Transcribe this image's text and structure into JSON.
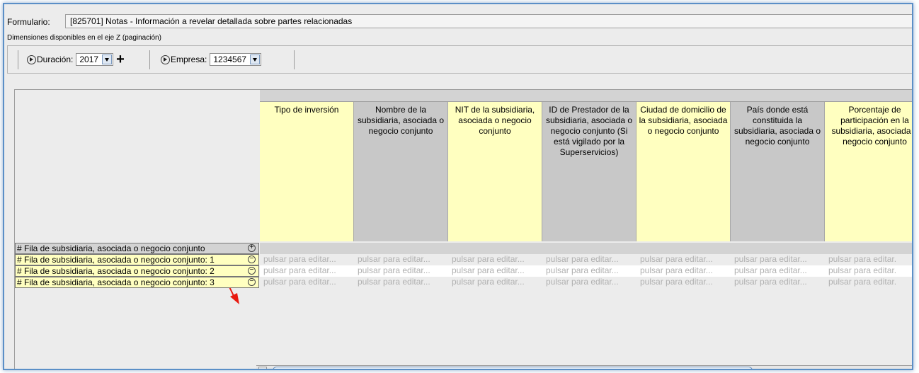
{
  "form": {
    "label": "Formulario:",
    "value": "[825701] Notas - Información a revelar detallada sobre partes relacionadas"
  },
  "z_axis_label": "Dimensiones disponibles en el eje Z (paginación)",
  "toolbar": {
    "duration_label": "Duración:",
    "duration_value": "2017",
    "company_label": "Empresa:",
    "company_value": "1234567"
  },
  "columns": [
    {
      "label": "Tipo de inversión",
      "color": "#ffffc0"
    },
    {
      "label": "Nombre de la subsidiaria, asociada o negocio conjunto",
      "color": "#c8c8c8"
    },
    {
      "label": "NIT de la subsidiaria, asociada o negocio conjunto",
      "color": "#ffffc0"
    },
    {
      "label": "ID de Prestador de la subsidiaria, asociada o negocio conjunto (Si está vigilado por la Superservicios)",
      "color": "#c8c8c8"
    },
    {
      "label": "Ciudad de domicilio de la subsidiaria, asociada o negocio conjunto",
      "color": "#ffffc0"
    },
    {
      "label": "País donde está constituida la subsidiaria, asociada o negocio conjunto",
      "color": "#c8c8c8"
    },
    {
      "label": "Porcentaje de participación en la subsidiaria, asociada o negocio conjunto",
      "color": "#ffffc0"
    }
  ],
  "rows": [
    {
      "label": "# Fila de subsidiaria, asociada o negocio conjunto",
      "toggle": "+"
    },
    {
      "label": "# Fila de subsidiaria, asociada o negocio conjunto: 1",
      "toggle": "−"
    },
    {
      "label": "# Fila de subsidiaria, asociada o negocio conjunto: 2",
      "toggle": "−"
    },
    {
      "label": "# Fila de subsidiaria, asociada o negocio conjunto: 3",
      "toggle": "−"
    }
  ],
  "cell_placeholder": "pulsar para editar...",
  "cell_placeholder_last": "pulsar para editar."
}
